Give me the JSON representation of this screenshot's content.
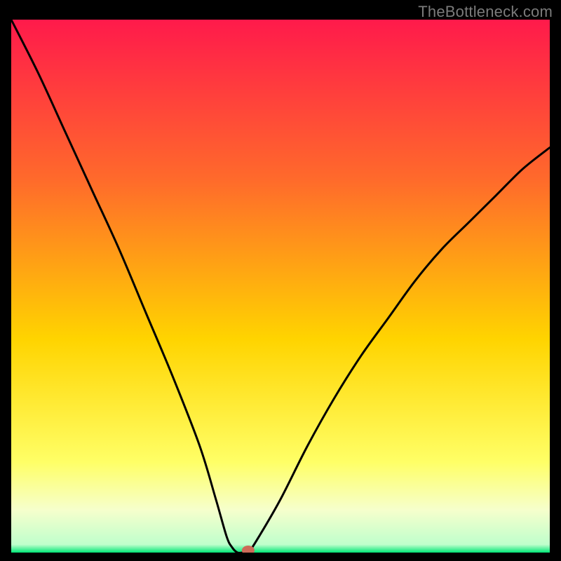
{
  "watermark": "TheBottleneck.com",
  "colors": {
    "bg_black": "#000000",
    "grad_top": "#ff1a4b",
    "grad_mid_upper": "#ff6a2b",
    "grad_mid": "#ffd400",
    "grad_low_yellow": "#ffff66",
    "grad_pale": "#f6ffcc",
    "grad_green": "#00e676",
    "curve": "#000000",
    "dot": "#cd6a58",
    "watermark": "#7b7b7b"
  },
  "chart_data": {
    "type": "line",
    "title": "",
    "xlabel": "",
    "ylabel": "",
    "x_range": [
      0,
      100
    ],
    "y_range": [
      0,
      100
    ],
    "series": [
      {
        "name": "bottleneck-curve",
        "x": [
          0,
          5,
          10,
          15,
          20,
          25,
          30,
          35,
          38,
          40,
          41,
          42,
          43,
          44,
          46,
          50,
          55,
          60,
          65,
          70,
          75,
          80,
          85,
          90,
          95,
          100
        ],
        "y": [
          100,
          90,
          79,
          68,
          57,
          45,
          33,
          20,
          10,
          3,
          1,
          0,
          0,
          0,
          3,
          10,
          20,
          29,
          37,
          44,
          51,
          57,
          62,
          67,
          72,
          76
        ]
      }
    ],
    "marker": {
      "x": 44,
      "y": 0,
      "color": "#cd6a58"
    },
    "background_gradient_stops": [
      {
        "pos": 0.0,
        "color": "#ff1a4b"
      },
      {
        "pos": 0.3,
        "color": "#ff6a2b"
      },
      {
        "pos": 0.6,
        "color": "#ffd400"
      },
      {
        "pos": 0.83,
        "color": "#ffff66"
      },
      {
        "pos": 0.92,
        "color": "#f6ffcc"
      },
      {
        "pos": 0.985,
        "color": "#bfffcc"
      },
      {
        "pos": 1.0,
        "color": "#00e676"
      }
    ]
  }
}
